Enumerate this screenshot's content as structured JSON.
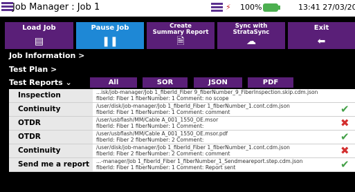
{
  "titlebar": {
    "title": "Job Manager : Job 1",
    "battery": "100%",
    "clock": "13:41 27/03/2020"
  },
  "toolbar": {
    "buttons": [
      {
        "label": "Load Job",
        "icon": "load-icon"
      },
      {
        "label": "Pause Job",
        "icon": "pause-icon",
        "active": true
      },
      {
        "label": "Create\nSummary Report",
        "icon": "report-icon"
      },
      {
        "label": "Sync with\nStrataSync",
        "icon": "cloud-icon"
      },
      {
        "label": "Exit",
        "icon": "back-arrow-icon"
      }
    ]
  },
  "tree": {
    "job_information": "Job Information >",
    "test_plan": "Test Plan >",
    "test_reports": "Test Reports ⌄"
  },
  "filters": [
    "All",
    "SOR",
    "JSON",
    "PDF"
  ],
  "reports": [
    {
      "name": "Inspection",
      "path": "...isk/job-manager/Job 1_fiberId_Fiber 9_fiberNumber_9_FiberInspection.skip.cdm.json",
      "meta": "fiberId: Fiber 1 fiberNumber: 1  Comment: no scope",
      "status": ""
    },
    {
      "name": "Continuity",
      "path": "/user/disk/job-manager/Job 1_fiberId_Fiber 1_fiberNumber_1.cont.cdm.json",
      "meta": "fiberId: Fiber 1 fiberNumber: 1  Comment: comment",
      "status": "ok"
    },
    {
      "name": "OTDR",
      "path": "/user/usbflash/MM/Cable A_001_1550_OE.msor",
      "meta": "fiberId: Fiber 1 fiberNumber: 1  Comment:",
      "status": "fail"
    },
    {
      "name": "OTDR",
      "path": "/user/usbflash/MM/Cable A_001_1550_OE.msor.pdf",
      "meta": "fiberId: Fiber 2 fiberNumber: 2  Comment:",
      "status": "ok"
    },
    {
      "name": "Continuity",
      "path": "/user/disk/job-manager/Job 1_fiberId_Fiber 1_fiberNumber_1.cont.cdm.json",
      "meta": "fiberId: Fiber 2 fiberNumber: 2  Comment: comment",
      "status": "fail"
    },
    {
      "name": "Send me a report",
      "path": "...-manager/Job 1_fiberId_Fiber 1_fiberNumber_1_Sendmeareport.step.cdm.json",
      "meta": "fiberId: Fiber 1 fiberNumber: 1  Comment: Report sent",
      "status": "ok"
    }
  ],
  "colors": {
    "accent": "#5a1f78",
    "active": "#1e88d6",
    "ok": "#43a047",
    "fail": "#d32f2f"
  }
}
